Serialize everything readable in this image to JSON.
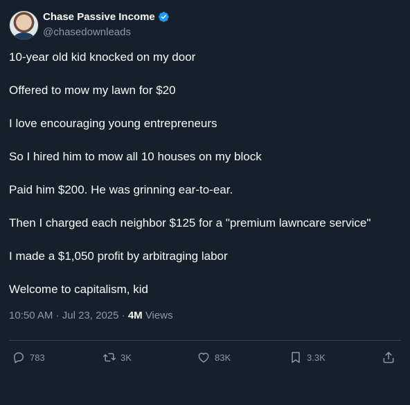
{
  "author": {
    "name": "Chase Passive Income",
    "handle": "@chasedownleads"
  },
  "tweet": {
    "lines": [
      "10-year old kid knocked on my door",
      "Offered to mow my lawn for $20",
      "I love encouraging young entrepreneurs",
      "So I hired him to mow all 10 houses on my block",
      "Paid him $200. He was grinning ear-to-ear.",
      "Then I charged each neighbor $125 for a \"premium lawncare service\"",
      "I made a $1,050 profit by arbitraging labor",
      "Welcome to capitalism, kid"
    ],
    "time": "10:50 AM",
    "date": "Jul 23, 2025",
    "views_count": "4M",
    "views_label": "Views"
  },
  "actions": {
    "replies": "783",
    "reposts": "3K",
    "likes": "83K",
    "bookmarks": "3.3K"
  },
  "colors": {
    "background": "#15202b",
    "text": "#f7f9f9",
    "muted": "#8b98a5",
    "verified": "#1d9bf0"
  },
  "icons": {
    "verified": "verified-badge-icon",
    "reply": "reply-icon",
    "repost": "repost-icon",
    "like": "heart-icon",
    "bookmark": "bookmark-icon",
    "share": "share-icon"
  }
}
